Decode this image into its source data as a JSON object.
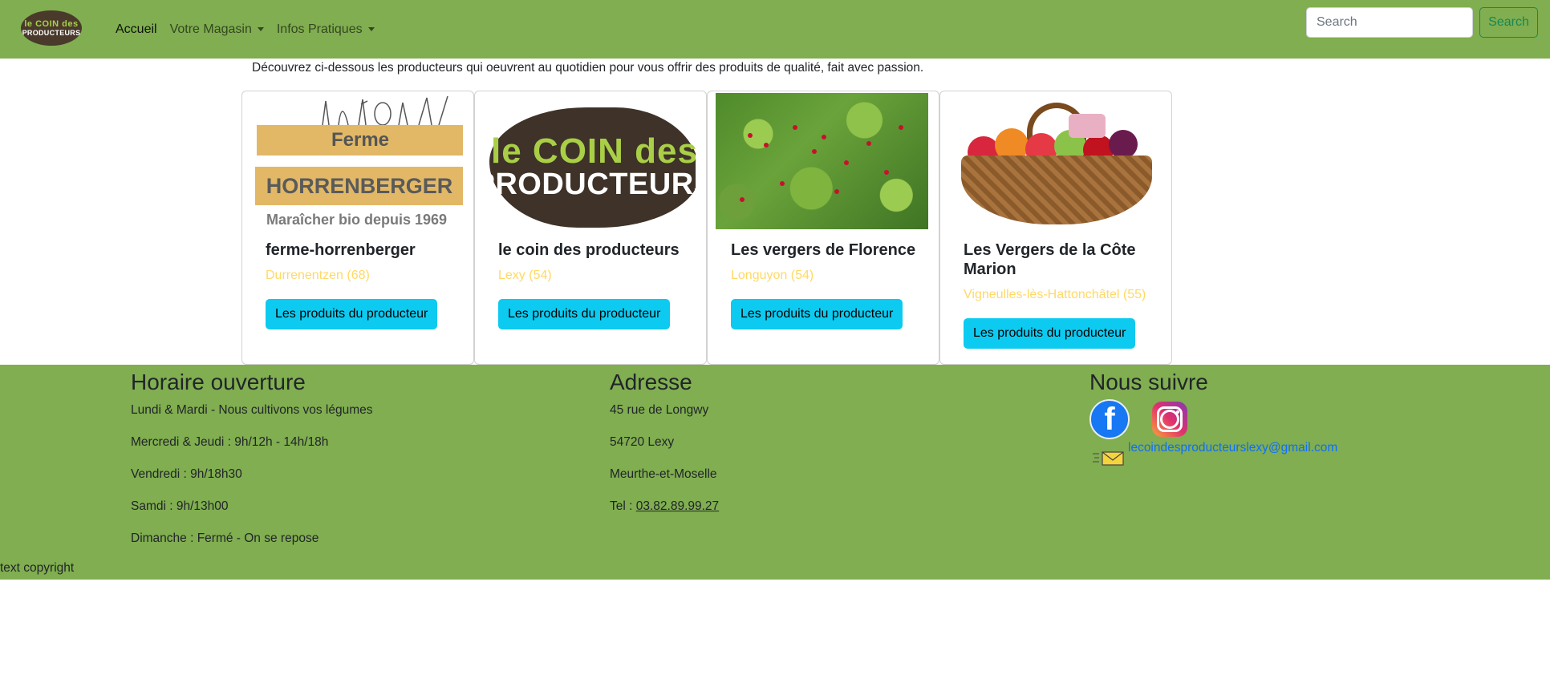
{
  "navbar": {
    "logo_line1": "le COIN des",
    "logo_line2": "PRODUCTEURS",
    "links": [
      {
        "label": "Accueil",
        "active": true,
        "dropdown": false
      },
      {
        "label": "Votre Magasin",
        "active": false,
        "dropdown": true
      },
      {
        "label": "Infos Pratiques",
        "active": false,
        "dropdown": true
      }
    ],
    "search_placeholder": "Search",
    "search_button": "Search",
    "color": "#80ae50"
  },
  "intro": "Découvrez ci-dessous les producteurs qui oeuvrent au quotidien pour vous offrir des produits de qualité, fait avec passion.",
  "producers": [
    {
      "name": "ferme-horrenberger",
      "location": "Durrenentzen (68)",
      "button": "Les produits du producteur",
      "image_text": {
        "top": "Ferme",
        "main": "HORRENBERGER",
        "sub": "Maraîcher bio depuis 1969"
      }
    },
    {
      "name": "le coin des producteurs",
      "location": "Lexy (54)",
      "button": "Les produits du producteur",
      "image_text": {
        "top": "le COIN des",
        "main": "PRODUCTEURS"
      }
    },
    {
      "name": "Les vergers de Florence",
      "location": "Longuyon (54)",
      "button": "Les produits du producteur"
    },
    {
      "name": "Les Vergers de la Côte Marion",
      "location": "Vigneulles-lès-Hattonchâtel (55)",
      "button": "Les produits du producteur"
    }
  ],
  "footer": {
    "hours": {
      "title": "Horaire ouverture",
      "lines": [
        "Lundi & Mardi - Nous cultivons vos légumes",
        "Mercredi & Jeudi : 9h/12h - 14h/18h",
        "Vendredi : 9h/18h30",
        "Samdi : 9h/13h00",
        "Dimanche : Fermé - On se repose"
      ]
    },
    "address": {
      "title": "Adresse",
      "street": "45 rue de Longwy",
      "city": "54720 Lexy",
      "region": "Meurthe-et-Moselle",
      "tel_label": "Tel : ",
      "tel": "03.82.89.99.27"
    },
    "follow": {
      "title": "Nous suivre",
      "facebook_letter": "f",
      "email": "lecoindesproducteurslexy@gmail.com"
    },
    "copyright": "text copyright"
  },
  "icons": [
    "facebook-icon",
    "instagram-icon",
    "mail-icon",
    "chevron-down-icon"
  ],
  "colors": {
    "accent_green": "#80ae50",
    "info_button": "#0dcaf0",
    "location_yellow": "#ffd966",
    "link_blue": "#0d6efd",
    "success_outline": "#198754"
  }
}
